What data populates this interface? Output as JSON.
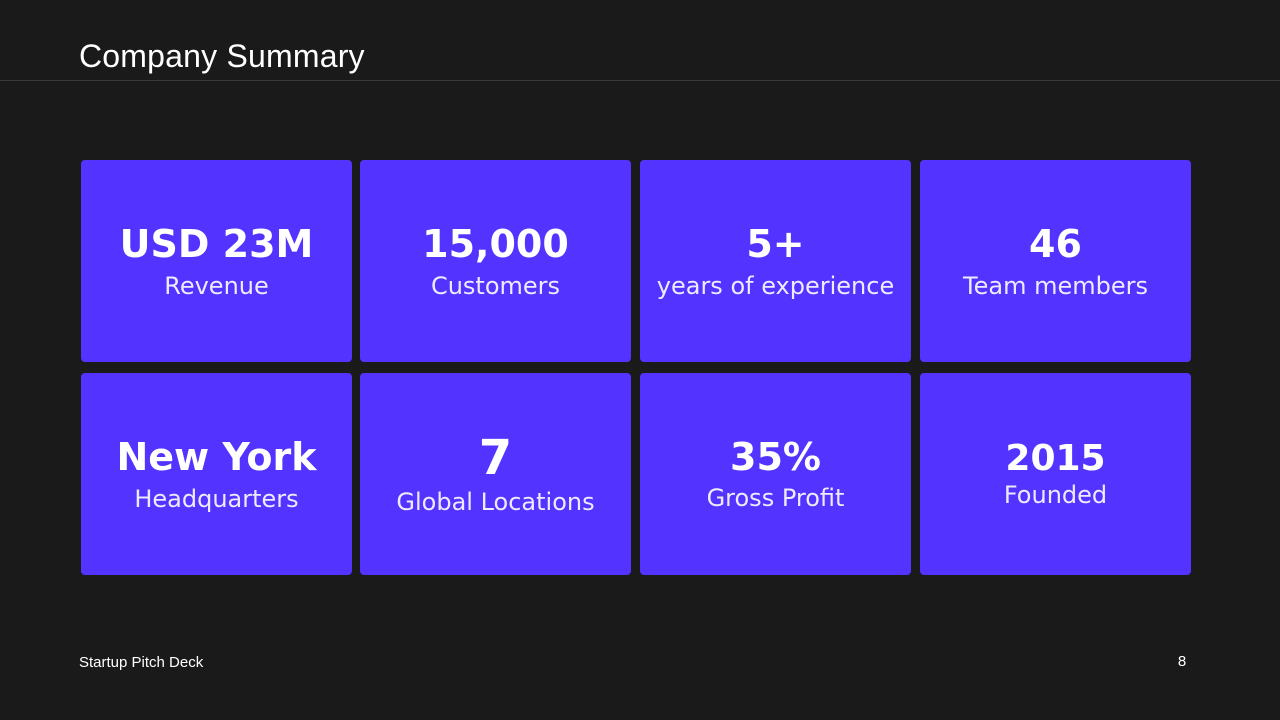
{
  "slide": {
    "title": "Company Summary",
    "footer": "Startup Pitch Deck",
    "page_number": "8"
  },
  "tiles": [
    {
      "value": "USD 23M",
      "label": "Revenue"
    },
    {
      "value": "15,000",
      "label": "Customers"
    },
    {
      "value": "5+",
      "label": "years of experience"
    },
    {
      "value": "46",
      "label": "Team members"
    },
    {
      "value": "New York",
      "label": "Headquarters"
    },
    {
      "value": "7",
      "label": "Global Locations"
    },
    {
      "value": "35%",
      "label": "Gross Profit"
    },
    {
      "value": "2015",
      "label": "Founded"
    }
  ],
  "colors": {
    "background": "#1a1a1a",
    "tile": "#5233ff",
    "text": "#ffffff"
  }
}
